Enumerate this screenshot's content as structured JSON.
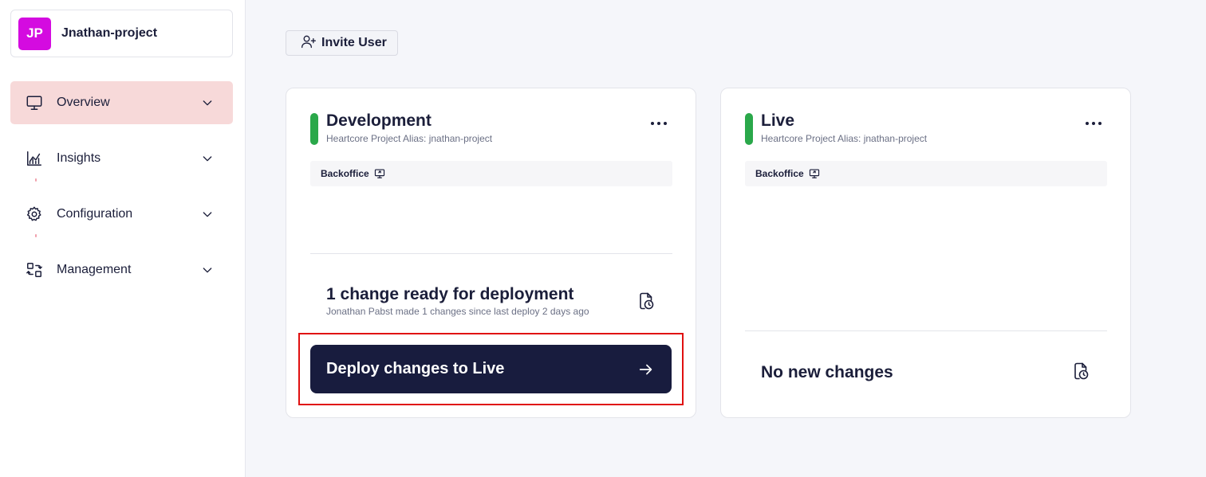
{
  "sidebar": {
    "project": {
      "initials": "JP",
      "name": "Jnathan-project",
      "avatar_color": "#d40be0"
    },
    "items": [
      {
        "label": "Overview",
        "icon": "monitor-icon",
        "active": true
      },
      {
        "label": "Insights",
        "icon": "chart-icon",
        "active": false
      },
      {
        "label": "Configuration",
        "icon": "gear-icon",
        "active": false
      },
      {
        "label": "Management",
        "icon": "management-icon",
        "active": false
      }
    ]
  },
  "main": {
    "invite_label": "Invite User",
    "environments": [
      {
        "title": "Development",
        "alias": "Heartcore Project Alias: jnathan-project",
        "backoffice_label": "Backoffice",
        "status_color": "#2aa84a",
        "change_title": "1 change ready for deployment",
        "change_sub": "Jonathan Pabst made 1 changes since last deploy 2 days ago",
        "deploy_label": "Deploy changes to Live"
      },
      {
        "title": "Live",
        "alias": "Heartcore Project Alias: jnathan-project",
        "backoffice_label": "Backoffice",
        "status_color": "#2aa84a",
        "no_changes_label": "No new changes"
      }
    ]
  },
  "colors": {
    "active_nav_bg": "#f7d9d9",
    "deploy_button_bg": "#181c3e",
    "highlight_outline": "#e01010"
  }
}
